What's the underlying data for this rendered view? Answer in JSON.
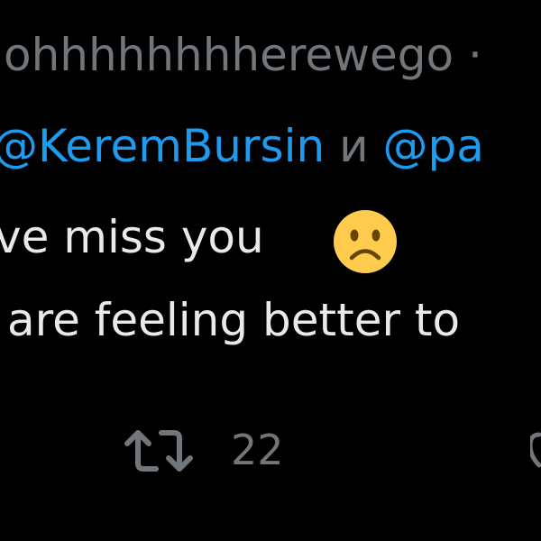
{
  "tweet": {
    "handle": "ohhhhhhhherewego ·",
    "reply_to": {
      "mention1": "@KeremBursin",
      "conjunction": " и ",
      "mention2": "@pa"
    },
    "body": {
      "line1": "ve miss you",
      "line2": " are feeling better to"
    },
    "emoji": "slightly-frowning-face-emoji",
    "actions": {
      "retweet_icon": "retweet-icon",
      "retweet_count": "22"
    }
  },
  "colors": {
    "background": "#000000",
    "secondary_text": "#71767b",
    "primary_text": "#e7e9ea",
    "mention": "#1d9bf0",
    "emoji_face": "#ffcc4d"
  }
}
